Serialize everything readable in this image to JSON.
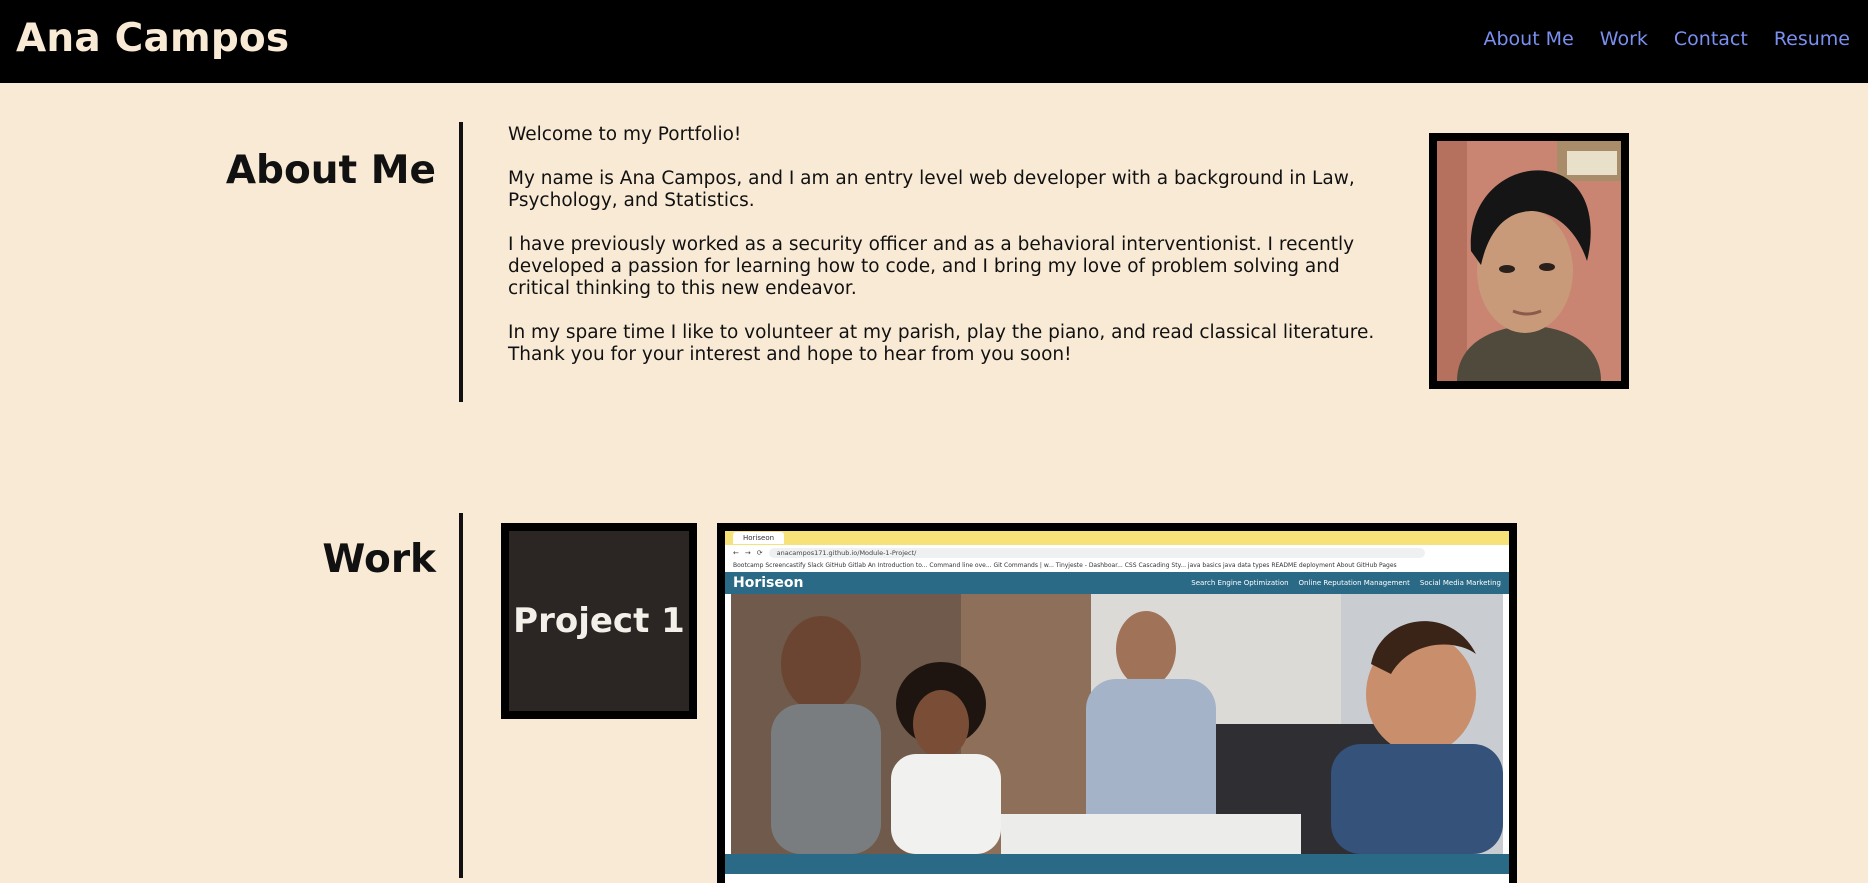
{
  "header": {
    "brand": "Ana Campos",
    "nav": [
      "About Me",
      "Work",
      "Contact",
      "Resume"
    ]
  },
  "about": {
    "title": "About Me",
    "paragraphs": [
      "Welcome to my Portfolio!",
      "My name is Ana Campos, and I am an entry level web developer with a background in Law, Psychology, and Statistics.",
      "I have previously worked as a security officer and as a behavioral interventionist. I recently developed a passion for learning how to code, and I bring my love of problem solving and critical thinking to this new endeavor.",
      "In my spare time I like to volunteer at my parish, play the piano, and read classical literature. Thank you for your interest and hope to hear from you soon!"
    ]
  },
  "work": {
    "title": "Work",
    "project_label": "Project 1",
    "screenshot": {
      "tab": "Horiseon",
      "url": "anacampos171.github.io/Module-1-Project/",
      "bookmarks": "Bootcamp  Screencastify  Slack  GitHub  Gitlab  An Introduction to...  Command line ove...  Git Commands | w...  Tinyjeste - Dashboar...  CSS Cascading Sty...  java basics  java data types  README  deployment  About GitHub Pages",
      "site_logo": "Horiseon",
      "site_nav": [
        "Search Engine Optimization",
        "Online Reputation Management",
        "Social Media Marketing"
      ]
    }
  },
  "colors": {
    "background": "#f9ead6",
    "header_bg": "#000000",
    "brand_text": "#f9ead6",
    "nav_link": "#7a8ff0",
    "project_tile": "#2b2624"
  }
}
